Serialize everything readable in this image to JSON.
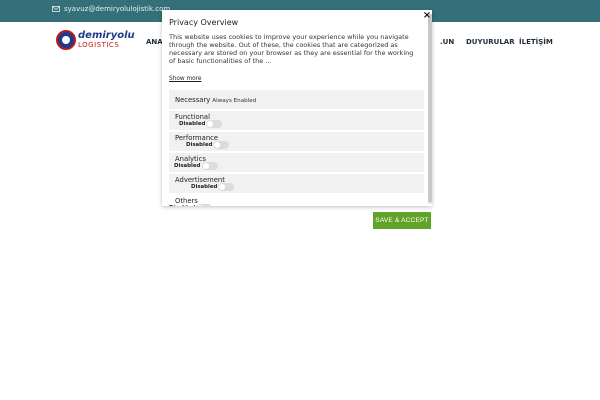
{
  "site": {
    "email": "syavuz@demiryolulojistik.com",
    "logo_name": "demiryolu",
    "logo_sub": "LOGISTICS",
    "nav": {
      "ana": "ANA",
      "un": ".UN",
      "duyurular": "DUYURULAR",
      "iletisim": "İLETİŞİM"
    }
  },
  "modal": {
    "title": "Privacy Overview",
    "description": "This website uses cookies to improve your experience while you navigate through the website. Out of these, the cookies that are categorized as necessary are stored on your browser as they are essential for the working of basic functionalities of the ...",
    "show_more": "Show more",
    "close_symbol": "×",
    "categories": [
      {
        "name": "Necessary",
        "state": "Always Enabled"
      },
      {
        "name": "Functional",
        "state": "Disabled"
      },
      {
        "name": "Performance",
        "state": "Disabled"
      },
      {
        "name": "Analytics",
        "state": "Disabled"
      },
      {
        "name": "Advertisement",
        "state": "Disabled"
      },
      {
        "name": "Others",
        "state": "Disabled"
      }
    ],
    "save_label": "SAVE & ACCEPT"
  },
  "colors": {
    "topbar": "#35707a",
    "save_button": "#61a229",
    "category_bg": "#f1f1f1"
  },
  "icons": {
    "email": "envelope-icon",
    "close": "close-icon"
  }
}
